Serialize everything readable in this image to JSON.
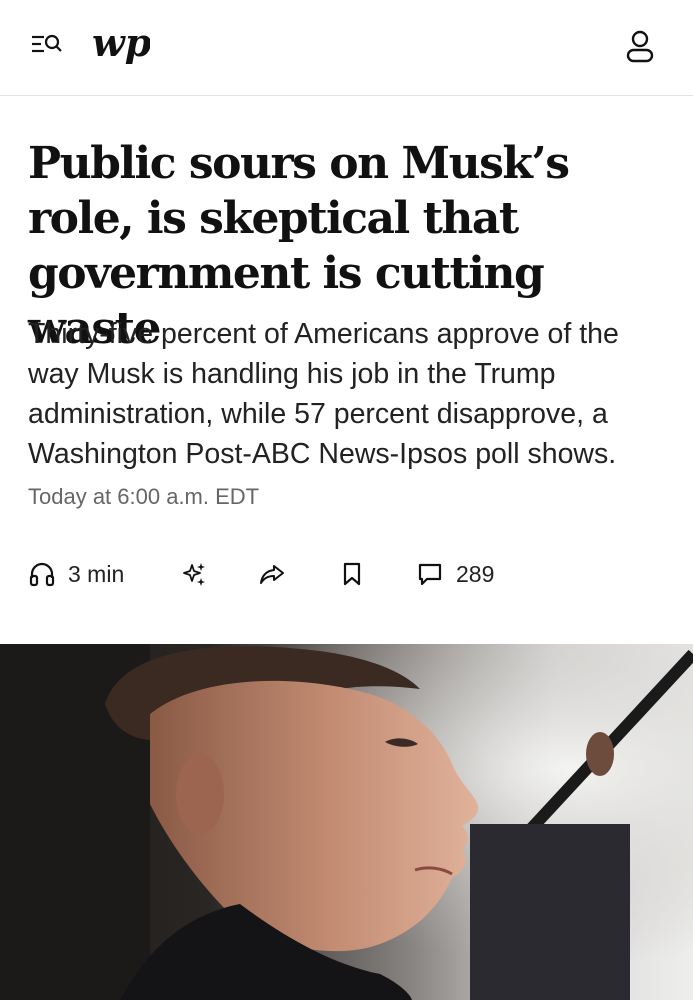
{
  "header": {
    "logo_text": "wp",
    "icons": [
      "menu-search-icon",
      "profile-icon"
    ]
  },
  "article": {
    "headline": "Public sours on Musk’s role, is skeptical that government is cutting waste",
    "dek": "Thirty-five percent of Americans approve of the way Musk is handling his job in the Trump administration, while 57 percent disapprove, a Washington Post-ABC News-Ipsos poll shows.",
    "timestamp": "Today at 6:00 a.m. EDT"
  },
  "actions": {
    "listen_label": "3 min",
    "comments_count": "289",
    "icons": [
      "headphones-icon",
      "gift-sparkle-icon",
      "share-arrow-icon",
      "bookmark-icon",
      "comment-icon"
    ]
  },
  "hero_image": {
    "subject": "photo"
  },
  "colors": {
    "text": "#111111",
    "meta": "#666666",
    "divider": "#e3e3e3",
    "background": "#ffffff"
  }
}
